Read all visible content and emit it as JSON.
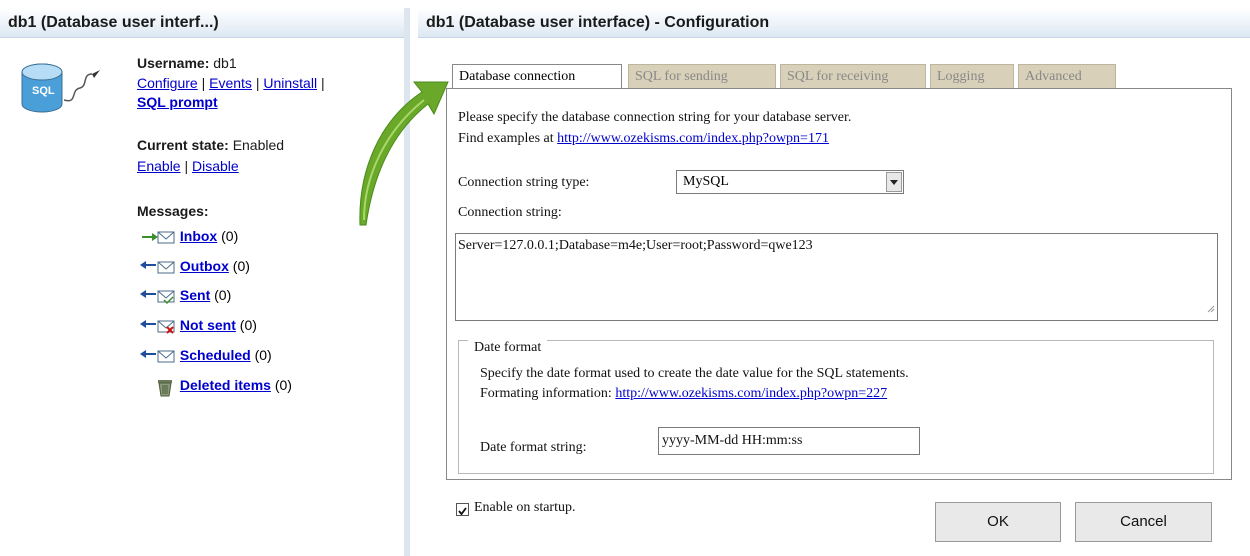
{
  "left_panel": {
    "title": "db1 (Database user interf...)",
    "db_icon_label": "SQL",
    "username_label": "Username:",
    "username_value": "db1",
    "links": {
      "configure": "Configure",
      "events": "Events",
      "uninstall": "Uninstall",
      "sep": "|",
      "sql_prompt": "SQL prompt"
    },
    "current_state_label": "Current state:",
    "current_state_value": "Enabled",
    "enable": "Enable",
    "disable": "Disable",
    "messages_label": "Messages:",
    "folders": [
      {
        "name": "Inbox",
        "count": "(0)",
        "icon": "inbox-envelope-icon"
      },
      {
        "name": "Outbox",
        "count": "(0)",
        "icon": "outbox-envelope-icon"
      },
      {
        "name": "Sent",
        "count": "(0)",
        "icon": "sent-envelope-icon"
      },
      {
        "name": "Not sent",
        "count": "(0)",
        "icon": "not-sent-envelope-icon"
      },
      {
        "name": "Scheduled",
        "count": "(0)",
        "icon": "scheduled-envelope-icon"
      },
      {
        "name": "Deleted items",
        "count": "(0)",
        "icon": "trash-bin-icon"
      }
    ]
  },
  "right_panel": {
    "title": "db1 (Database user interface) - Configuration",
    "tabs": [
      {
        "label": "Database connection",
        "active": true
      },
      {
        "label": "SQL for sending",
        "active": false
      },
      {
        "label": "SQL for receiving",
        "active": false
      },
      {
        "label": "Logging",
        "active": false
      },
      {
        "label": "Advanced",
        "active": false
      }
    ],
    "intro_line1": "Please specify the database connection string for your database server.",
    "intro_line2_prefix": "Find examples at",
    "intro_link": "http://www.ozekisms.com/index.php?owpn=171",
    "connection_type_label": "Connection string type:",
    "connection_type_value": "MySQL",
    "connection_string_label": "Connection string:",
    "connection_string_value": "Server=127.0.0.1;Database=m4e;User=root;Password=qwe123",
    "date_format": {
      "legend": "Date format",
      "desc": "Specify the date format used to create the date value for the SQL statements.",
      "info_prefix": "Formating information:",
      "info_link": "http://www.ozekisms.com/index.php?owpn=227",
      "string_label": "Date format string:",
      "string_value": "yyyy-MM-dd HH:mm:ss"
    },
    "enable_on_startup_label": "Enable on startup.",
    "enable_on_startup_checked": true,
    "ok_label": "OK",
    "cancel_label": "Cancel"
  }
}
